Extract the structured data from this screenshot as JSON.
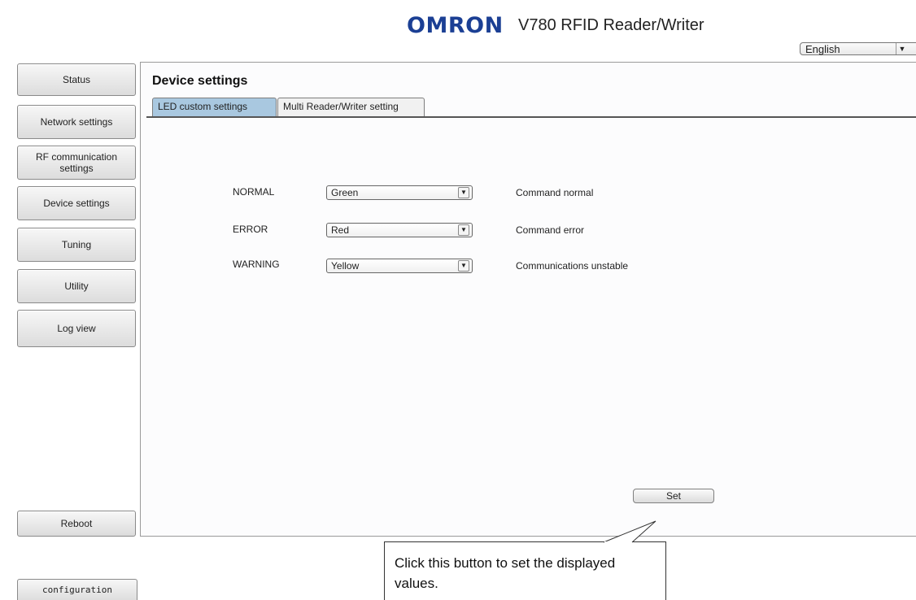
{
  "header": {
    "brand": "OMRON",
    "title": "V780 RFID Reader/Writer",
    "language": {
      "selected": "English"
    }
  },
  "sidebar": {
    "items": [
      {
        "label": "Status"
      },
      {
        "label": "Network settings"
      },
      {
        "label": "RF communication settings"
      },
      {
        "label": "Device settings"
      },
      {
        "label": "Tuning"
      },
      {
        "label": "Utility"
      },
      {
        "label": "Log view"
      }
    ],
    "reboot_label": "Reboot",
    "configuration_label": "configuration"
  },
  "main": {
    "title": "Device settings",
    "tabs": [
      {
        "label": "LED custom settings",
        "active": true
      },
      {
        "label": "Multi Reader/Writer setting",
        "active": false
      }
    ],
    "rows": [
      {
        "label": "NORMAL",
        "value": "Green",
        "description": "Command normal"
      },
      {
        "label": "ERROR",
        "value": "Red",
        "description": "Command error"
      },
      {
        "label": "WARNING",
        "value": "Yellow",
        "description": "Communications unstable"
      }
    ],
    "set_label": "Set"
  },
  "callout": {
    "text": "Click this button to set the displayed values."
  },
  "colors": {
    "brand": "#1b3f94",
    "active_tab": "#a9c8e0"
  }
}
